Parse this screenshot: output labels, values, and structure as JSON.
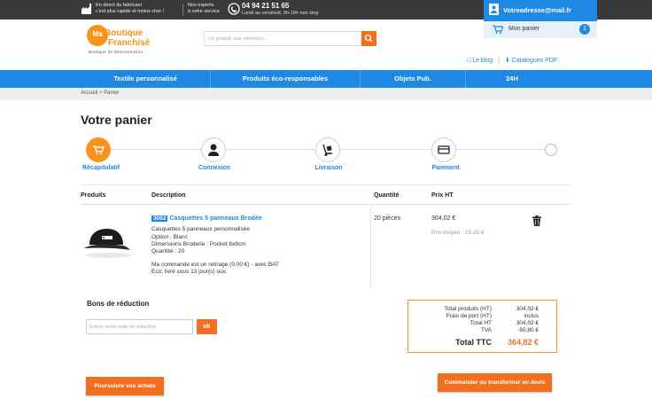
{
  "topbar": {
    "factory_line1": "En direct du fabricant",
    "factory_line2": "c'est plus rapide et moins cher !",
    "experts_line1": "Nos experts",
    "experts_line2": "à votre service",
    "phone": "04 94 21 51 65",
    "hours": "Lundi au vendredi, 9h-18h non stop"
  },
  "account": {
    "email": "Votreadresse@mail.fr"
  },
  "cart": {
    "label": "Mon panier",
    "count": "1"
  },
  "logo": {
    "line1": "Boutique",
    "line2": "Franchisé",
    "ma": "Ma",
    "tagline": "Boutique de démonstration"
  },
  "search": {
    "placeholder": "Un produit, une référence..."
  },
  "links": {
    "blog": "Le blog",
    "catalogues": "Catalogues PDF"
  },
  "nav": [
    "Textile personnalisé",
    "Produits éco-responsables",
    "Objets Pub.",
    "24H"
  ],
  "breadcrumb": "Accueil > Panier",
  "page_title": "Votre panier",
  "steps": [
    "Récapitulatif",
    "Connexion",
    "Livraison",
    "Paiement"
  ],
  "table": {
    "headers": {
      "products": "Produits",
      "description": "Description",
      "quantity": "Quantité",
      "price": "Prix HT"
    },
    "item": {
      "ref": "3062",
      "title": "Casquettes 5 panneaux Brodée",
      "desc": [
        "Casquettes 5 panneaux personnalisée",
        "Option : Blanc",
        "Dimensions Broderie : Pocket 8x8cm",
        "Quantité : 20"
      ],
      "note1": "Ma commande est un retirage (0,00 €) - avec BAT",
      "note2": "Eco, livré sous 13 jour(s) ouv.",
      "qty": "20 pièces",
      "price": "304,02 €",
      "avg_price": "Prix moyen : 15,20 €"
    }
  },
  "coupon": {
    "title": "Bons de réduction",
    "placeholder": "Entrez votre code de réduction",
    "ok": "ok"
  },
  "totals": {
    "rows": [
      {
        "label": "Total produits (HT)",
        "value": "304,02 €"
      },
      {
        "label": "Frais de port (HT)",
        "value": "inclus"
      },
      {
        "label": "Total HT",
        "value": "304,02 €"
      },
      {
        "label": "TVA",
        "value": "60,80 €"
      }
    ],
    "ttc_label": "Total TTC",
    "ttc_value": "364,82 €"
  },
  "buttons": {
    "continue": "Poursuivre vos achats",
    "order": "Commander ou transformer en devis"
  },
  "colors": {
    "accent": "#f26f21",
    "brand": "#1e88e5",
    "topbar": "#3a3a3a"
  }
}
